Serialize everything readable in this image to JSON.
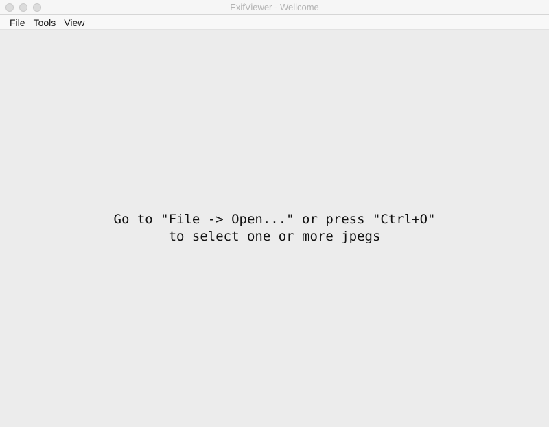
{
  "window": {
    "title": "ExifViewer - Wellcome",
    "traffic_lights": [
      "close-icon",
      "minimize-icon",
      "zoom-icon"
    ]
  },
  "menubar": {
    "items": [
      {
        "label": "File"
      },
      {
        "label": "Tools"
      },
      {
        "label": "View"
      }
    ]
  },
  "content": {
    "message_line1": "Go to \"File -> Open...\" or press \"Ctrl+O\"",
    "message_line2": "to select one or more jpegs"
  },
  "colors": {
    "background": "#ececec",
    "title_text": "#b3b3b3",
    "menu_text": "#1a1a1a",
    "message_text": "#111111"
  }
}
